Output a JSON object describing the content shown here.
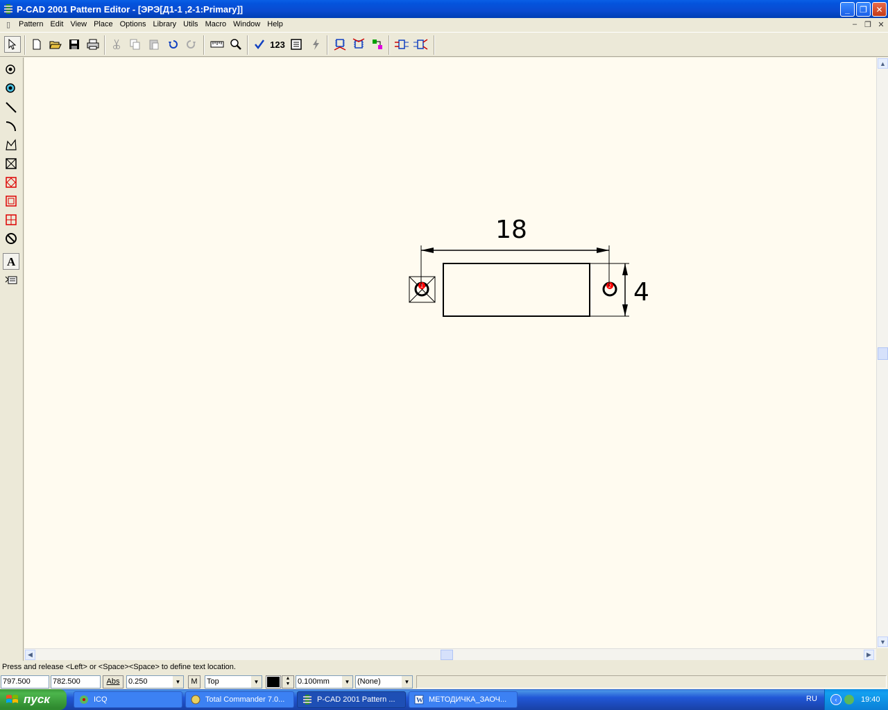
{
  "window": {
    "title": "P-CAD 2001 Pattern Editor - [ЭРЭ[Д1-1 ,2-1:Primary]]",
    "minimize": "_",
    "maximize": "❐",
    "close": "✕"
  },
  "menu": {
    "items": [
      "Pattern",
      "Edit",
      "View",
      "Place",
      "Options",
      "Library",
      "Utils",
      "Macro",
      "Window",
      "Help"
    ]
  },
  "toolbar": {
    "counter_label": "123"
  },
  "drawing": {
    "dimension_horizontal": "18",
    "dimension_vertical": "4",
    "pad1_number": "1",
    "pad2_number": "2"
  },
  "status": {
    "prompt": "Press and release <Left> or <Space><Space> to define text location.",
    "x_coord": "797.500",
    "y_coord": "782.500",
    "abs_label": "Abs",
    "grid": "0.250",
    "m_label": "M",
    "layer": "Top",
    "line_width": "0.100mm",
    "style": "(None)",
    "layer_color": "#000000"
  },
  "taskbar": {
    "start": "пуск",
    "tasks": [
      "ICQ",
      "Total Commander 7.0...",
      "P-CAD 2001 Pattern ...",
      "МЕТОДИЧКА_ЗАОЧ..."
    ],
    "lang": "RU",
    "clock": "19:40"
  },
  "colors": {
    "canvas_bg": "#fffbf0",
    "pad_highlight": "#ff0000",
    "title_blue": "#0a4bd0"
  }
}
